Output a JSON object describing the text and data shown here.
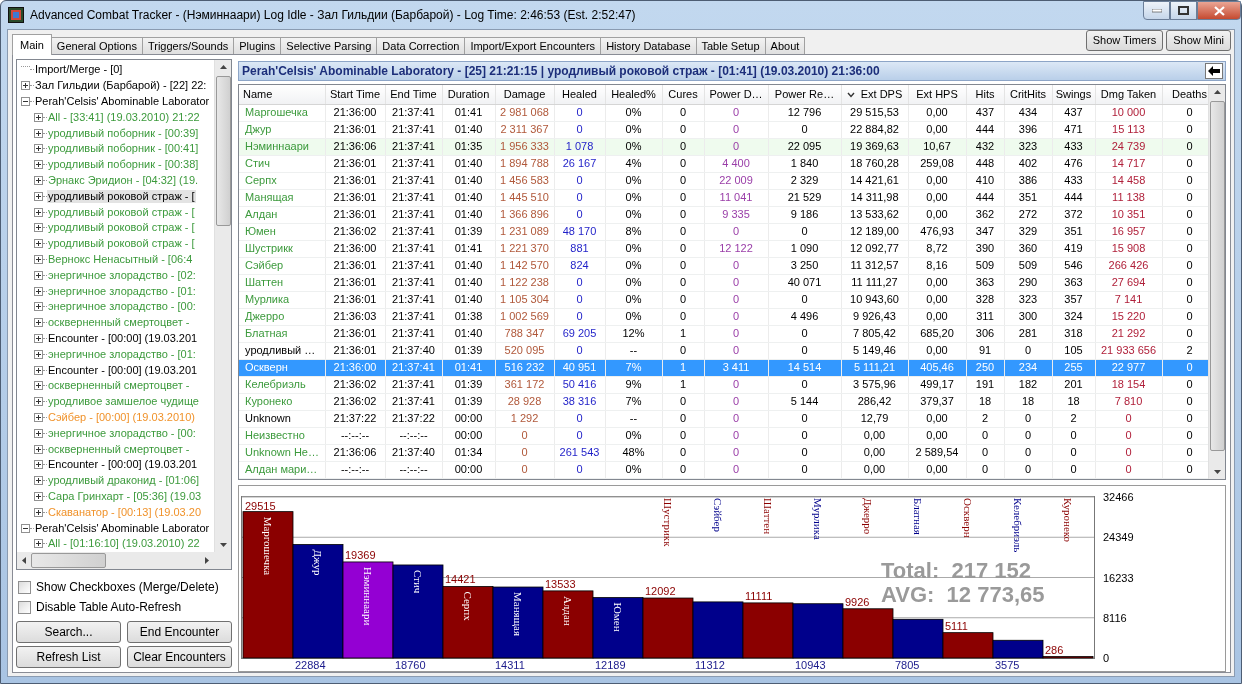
{
  "window": {
    "title": "Advanced Combat Tracker - (Нэминнаари) Log Idle - Зал Гильдии (Барбарой) - Log Time: 2:46:53 (Est. 2:52:47)"
  },
  "tabs": [
    {
      "label": "Main",
      "selected": true
    },
    {
      "label": "General Options",
      "selected": false
    },
    {
      "label": "Triggers/Sounds",
      "selected": false
    },
    {
      "label": "Plugins",
      "selected": false
    },
    {
      "label": "Selective Parsing",
      "selected": false
    },
    {
      "label": "Data Correction",
      "selected": false
    },
    {
      "label": "Import/Export Encounters",
      "selected": false
    },
    {
      "label": "History Database",
      "selected": false
    },
    {
      "label": "Table Setup",
      "selected": false
    },
    {
      "label": "About",
      "selected": false
    }
  ],
  "top_buttons": [
    "Show Timers",
    "Show Mini"
  ],
  "tree": [
    {
      "label": "Import/Merge - [0]",
      "selected": false,
      "color": "#000000"
    },
    {
      "label": "Зал Гильдии (Барбарой) - [22] 22:",
      "selected": false,
      "color": "#000000",
      "expanded": false
    },
    {
      "label": "Perah'Celsis' Abominable Laborator",
      "selected": false,
      "color": "#000000",
      "expanded": true,
      "children": [
        {
          "label": "All - [33:41] (19.03.2010) 21:22",
          "selected": false,
          "color": "#3c9a3c",
          "expanded": false
        },
        {
          "label": "уродливый поборник - [00:39]",
          "selected": false,
          "color": "#3c9a3c",
          "expanded": false
        },
        {
          "label": "уродливый поборник - [00:41]",
          "selected": false,
          "color": "#3c9a3c",
          "expanded": false
        },
        {
          "label": "уродливый поборник - [00:38]",
          "selected": false,
          "color": "#3c9a3c",
          "expanded": false
        },
        {
          "label": "Эрнакс Эридион - [04:32] (19.",
          "selected": false,
          "color": "#3c9a3c",
          "expanded": false
        },
        {
          "label": "уродливый роковой страж - [",
          "selected": true,
          "color": "#000000",
          "expanded": false
        },
        {
          "label": "уродливый роковой страж - [",
          "selected": false,
          "color": "#3c9a3c",
          "expanded": false
        },
        {
          "label": "уродливый роковой страж - [",
          "selected": false,
          "color": "#3c9a3c",
          "expanded": false
        },
        {
          "label": "уродливый роковой страж - [",
          "selected": false,
          "color": "#3c9a3c",
          "expanded": false
        },
        {
          "label": "Вернокс Ненасытный - [06:4",
          "selected": false,
          "color": "#3c9a3c",
          "expanded": false
        },
        {
          "label": "энергичное злорадство - [02:",
          "selected": false,
          "color": "#3c9a3c",
          "expanded": false
        },
        {
          "label": "энергичное злорадство - [01:",
          "selected": false,
          "color": "#3c9a3c",
          "expanded": false
        },
        {
          "label": "энергичное злорадство - [00:",
          "selected": false,
          "color": "#3c9a3c",
          "expanded": false
        },
        {
          "label": "оскверненный смертоцвет -",
          "selected": false,
          "color": "#3c9a3c",
          "expanded": false
        },
        {
          "label": "Encounter - [00:00] (19.03.201",
          "selected": false,
          "color": "#000000",
          "expanded": false
        },
        {
          "label": "энергичное злорадство - [01:",
          "selected": false,
          "color": "#3c9a3c",
          "expanded": false
        },
        {
          "label": "Encounter - [00:00] (19.03.201",
          "selected": false,
          "color": "#000000",
          "expanded": false
        },
        {
          "label": "оскверненный смертоцвет -",
          "selected": false,
          "color": "#3c9a3c",
          "expanded": false
        },
        {
          "label": "уродливое замшелое чудище",
          "selected": false,
          "color": "#3c9a3c",
          "expanded": false
        },
        {
          "label": "Сэйбер - [00:00] (19.03.2010)",
          "selected": false,
          "color": "#f0922a",
          "expanded": false
        },
        {
          "label": "энергичное злорадство - [00:",
          "selected": false,
          "color": "#3c9a3c",
          "expanded": false
        },
        {
          "label": "оскверненный смертоцвет -",
          "selected": false,
          "color": "#3c9a3c",
          "expanded": false
        },
        {
          "label": "Encounter - [00:00] (19.03.201",
          "selected": false,
          "color": "#000000",
          "expanded": false
        },
        {
          "label": "уродливый драконид - [01:06]",
          "selected": false,
          "color": "#3c9a3c",
          "expanded": false
        },
        {
          "label": "Сара Гринхарт - [05:36] (19.03",
          "selected": false,
          "color": "#3c9a3c",
          "expanded": false
        },
        {
          "label": "Скаванатор - [00:13] (19.03.20",
          "selected": false,
          "color": "#f0922a",
          "expanded": false
        }
      ]
    },
    {
      "label": "Perah'Celsis' Abominable Laborator",
      "selected": false,
      "color": "#000000",
      "expanded": true,
      "children": [
        {
          "label": "All - [01:16:10] (19.03.2010) 22",
          "selected": false,
          "color": "#3c9a3c",
          "expanded": false
        }
      ]
    }
  ],
  "options": [
    {
      "label": "Show Checkboxes (Merge/Delete)",
      "checked": false
    },
    {
      "label": "Disable Table Auto-Refresh",
      "checked": false
    }
  ],
  "left_buttons": [
    "Search...",
    "End Encounter",
    "Refresh List",
    "Clear Encounters"
  ],
  "encounter_header": "Perah'Celsis' Abominable Laboratory - [25] 21:21:15  |  уродливый роковой страж - [01:41] (19.03.2010) 21:36:00",
  "table": {
    "columns": [
      {
        "label": "Name",
        "kind": "name",
        "sorted": false
      },
      {
        "label": "Start Time",
        "kind": "plain",
        "sorted": false
      },
      {
        "label": "End Time",
        "kind": "plain",
        "sorted": false
      },
      {
        "label": "Duration",
        "kind": "plain",
        "sorted": false
      },
      {
        "label": "Damage",
        "kind": "damage",
        "sorted": false
      },
      {
        "label": "Healed",
        "kind": "healing",
        "sorted": false
      },
      {
        "label": "Healed%",
        "kind": "plain",
        "sorted": false
      },
      {
        "label": "Cures",
        "kind": "plain",
        "sorted": false
      },
      {
        "label": "Power D…",
        "kind": "drain",
        "sorted": false
      },
      {
        "label": "Power Re…",
        "kind": "plain",
        "sorted": false
      },
      {
        "label": "Ext DPS",
        "kind": "plain",
        "sorted": true
      },
      {
        "label": "Ext HPS",
        "kind": "plain",
        "sorted": false
      },
      {
        "label": "Hits",
        "kind": "plain",
        "sorted": false
      },
      {
        "label": "CritHits",
        "kind": "plain",
        "sorted": false
      },
      {
        "label": "Swings",
        "kind": "plain",
        "sorted": false
      },
      {
        "label": "Dmg Taken",
        "kind": "taken",
        "sorted": false
      },
      {
        "label": "Deaths",
        "kind": "plain",
        "sorted": false
      }
    ],
    "rows": [
      {
        "kind": "player",
        "self": false,
        "selected": false,
        "cells": [
          "Маргошечка",
          "21:36:00",
          "21:37:41",
          "01:41",
          "2 981 068",
          "0",
          "0%",
          "0",
          "0",
          "12 796",
          "29 515,53",
          "0,00",
          "437",
          "434",
          "437",
          "10 000",
          "0"
        ]
      },
      {
        "kind": "player",
        "self": false,
        "selected": false,
        "cells": [
          "Джур",
          "21:36:01",
          "21:37:41",
          "01:40",
          "2 311 367",
          "0",
          "0%",
          "0",
          "0",
          "0",
          "22 884,82",
          "0,00",
          "444",
          "396",
          "471",
          "15 113",
          "0"
        ]
      },
      {
        "kind": "player",
        "self": true,
        "selected": false,
        "cells": [
          "Нэминнаари",
          "21:36:06",
          "21:37:41",
          "01:35",
          "1 956 333",
          "1 078",
          "0%",
          "0",
          "0",
          "22 095",
          "19 369,63",
          "10,67",
          "432",
          "323",
          "433",
          "24 739",
          "0"
        ]
      },
      {
        "kind": "player",
        "self": false,
        "selected": false,
        "cells": [
          "Стич",
          "21:36:01",
          "21:37:41",
          "01:40",
          "1 894 788",
          "26 167",
          "4%",
          "0",
          "4 400",
          "1 840",
          "18 760,28",
          "259,08",
          "448",
          "402",
          "476",
          "14 717",
          "0"
        ]
      },
      {
        "kind": "player",
        "self": false,
        "selected": false,
        "cells": [
          "Серпх",
          "21:36:01",
          "21:37:41",
          "01:40",
          "1 456 583",
          "0",
          "0%",
          "0",
          "22 009",
          "2 329",
          "14 421,61",
          "0,00",
          "410",
          "386",
          "433",
          "14 458",
          "0"
        ]
      },
      {
        "kind": "player",
        "self": false,
        "selected": false,
        "cells": [
          "Манящая",
          "21:36:01",
          "21:37:41",
          "01:40",
          "1 445 510",
          "0",
          "0%",
          "0",
          "11 041",
          "21 529",
          "14 311,98",
          "0,00",
          "444",
          "351",
          "444",
          "11 138",
          "0"
        ]
      },
      {
        "kind": "player",
        "self": false,
        "selected": false,
        "cells": [
          "Алдан",
          "21:36:01",
          "21:37:41",
          "01:40",
          "1 366 896",
          "0",
          "0%",
          "0",
          "9 335",
          "9 186",
          "13 533,62",
          "0,00",
          "362",
          "272",
          "372",
          "10 351",
          "0"
        ]
      },
      {
        "kind": "player",
        "self": false,
        "selected": false,
        "cells": [
          "Юмен",
          "21:36:02",
          "21:37:41",
          "01:39",
          "1 231 089",
          "48 170",
          "8%",
          "0",
          "0",
          "0",
          "12 189,00",
          "476,93",
          "347",
          "329",
          "351",
          "16 957",
          "0"
        ]
      },
      {
        "kind": "player",
        "self": false,
        "selected": false,
        "cells": [
          "Шустрикк",
          "21:36:00",
          "21:37:41",
          "01:41",
          "1 221 370",
          "881",
          "0%",
          "0",
          "12 122",
          "1 090",
          "12 092,77",
          "8,72",
          "390",
          "360",
          "419",
          "15 908",
          "0"
        ]
      },
      {
        "kind": "player",
        "self": false,
        "selected": false,
        "cells": [
          "Сэйбер",
          "21:36:01",
          "21:37:41",
          "01:40",
          "1 142 570",
          "824",
          "0%",
          "0",
          "0",
          "3 250",
          "11 312,57",
          "8,16",
          "509",
          "509",
          "546",
          "266 426",
          "0"
        ]
      },
      {
        "kind": "player",
        "self": false,
        "selected": false,
        "cells": [
          "Шаттен",
          "21:36:01",
          "21:37:41",
          "01:40",
          "1 122 238",
          "0",
          "0%",
          "0",
          "0",
          "40 071",
          "11 111,27",
          "0,00",
          "363",
          "290",
          "363",
          "27 694",
          "0"
        ]
      },
      {
        "kind": "player",
        "self": false,
        "selected": false,
        "cells": [
          "Мурлика",
          "21:36:01",
          "21:37:41",
          "01:40",
          "1 105 304",
          "0",
          "0%",
          "0",
          "0",
          "0",
          "10 943,60",
          "0,00",
          "328",
          "323",
          "357",
          "7 141",
          "0"
        ]
      },
      {
        "kind": "player",
        "self": false,
        "selected": false,
        "cells": [
          "Джерро",
          "21:36:03",
          "21:37:41",
          "01:38",
          "1 002 569",
          "0",
          "0%",
          "0",
          "0",
          "4 496",
          "9 926,43",
          "0,00",
          "311",
          "300",
          "324",
          "15 220",
          "0"
        ]
      },
      {
        "kind": "player",
        "self": false,
        "selected": false,
        "cells": [
          "Блатная",
          "21:36:01",
          "21:37:41",
          "01:40",
          "788 347",
          "69 205",
          "12%",
          "1",
          "0",
          "0",
          "7 805,42",
          "685,20",
          "306",
          "281",
          "318",
          "21 292",
          "0"
        ]
      },
      {
        "kind": "other",
        "self": false,
        "selected": false,
        "cells": [
          "уродливый …",
          "21:36:01",
          "21:37:40",
          "01:39",
          "520 095",
          "0",
          "--",
          "0",
          "0",
          "0",
          "5 149,46",
          "0,00",
          "91",
          "0",
          "105",
          "21 933 656",
          "2"
        ]
      },
      {
        "kind": "player",
        "self": false,
        "selected": true,
        "cells": [
          "Оскверн",
          "21:36:00",
          "21:37:41",
          "01:41",
          "516 232",
          "40 951",
          "7%",
          "1",
          "3 411",
          "14 514",
          "5 111,21",
          "405,46",
          "250",
          "234",
          "255",
          "22 977",
          "0"
        ]
      },
      {
        "kind": "player",
        "self": false,
        "selected": false,
        "cells": [
          "Келебриэль",
          "21:36:02",
          "21:37:41",
          "01:39",
          "361 172",
          "50 416",
          "9%",
          "1",
          "0",
          "0",
          "3 575,96",
          "499,17",
          "191",
          "182",
          "201",
          "18 154",
          "0"
        ]
      },
      {
        "kind": "player",
        "self": false,
        "selected": false,
        "cells": [
          "Куронеко",
          "21:36:02",
          "21:37:41",
          "01:39",
          "28 928",
          "38 316",
          "7%",
          "0",
          "0",
          "5 144",
          "286,42",
          "379,37",
          "18",
          "18",
          "18",
          "7 810",
          "0"
        ]
      },
      {
        "kind": "other",
        "self": false,
        "selected": false,
        "cells": [
          "Unknown",
          "21:37:22",
          "21:37:22",
          "00:00",
          "1 292",
          "0",
          "--",
          "0",
          "0",
          "0",
          "12,79",
          "0,00",
          "2",
          "0",
          "2",
          "0",
          "0"
        ]
      },
      {
        "kind": "player",
        "self": false,
        "selected": false,
        "cells": [
          "Неизвестно",
          "--:--:--",
          "--:--:--",
          "00:00",
          "0",
          "0",
          "0%",
          "0",
          "0",
          "0",
          "0,00",
          "0,00",
          "0",
          "0",
          "0",
          "0",
          "0"
        ]
      },
      {
        "kind": "player",
        "self": false,
        "selected": false,
        "cells": [
          "Unknown Не…",
          "21:36:06",
          "21:37:40",
          "01:34",
          "0",
          "261 543",
          "48%",
          "0",
          "0",
          "0",
          "0,00",
          "2 589,54",
          "0",
          "0",
          "0",
          "0",
          "0"
        ]
      },
      {
        "kind": "player",
        "self": false,
        "selected": false,
        "cells": [
          "Алдан мари…",
          "--:--:--",
          "--:--:--",
          "00:00",
          "0",
          "0",
          "0%",
          "0",
          "0",
          "0",
          "0,00",
          "0,00",
          "0",
          "0",
          "0",
          "0",
          "0"
        ]
      }
    ]
  },
  "chart": {
    "chart_data": {
      "type": "bar",
      "categories": [
        "Маргошечка",
        "Джур",
        "Нэминнаари",
        "Стич",
        "Серпх",
        "Манящая",
        "Алдан",
        "Юмен",
        "Шустрикк",
        "Сэйбер",
        "Шаттен",
        "Мурлика",
        "Джерро",
        "Блатная",
        "Оскверн",
        "Келебриэль",
        "Куронеко"
      ],
      "series": [
        {
          "values": [
            29515,
            22884,
            19369,
            18760,
            14421,
            14311,
            13533,
            12189,
            12092,
            11312,
            11111,
            10943,
            9926,
            7805,
            5111,
            3575,
            286
          ]
        }
      ],
      "colors": [
        "#8b0000",
        "#00008b",
        "#9400d3",
        "#00008b",
        "#8b0000",
        "#00008b",
        "#8b0000",
        "#00008b",
        "#8b0000",
        "#00008b",
        "#8b0000",
        "#00008b",
        "#8b0000",
        "#00008b",
        "#8b0000",
        "#00008b",
        "#8b0000"
      ],
      "grid": true,
      "ylim": [
        0,
        32466
      ],
      "yticks": [
        0,
        8116,
        16233,
        24349,
        32466
      ],
      "data_labels": true,
      "annotations": [
        {
          "text": "Total:  217 152"
        },
        {
          "text": "AVG:  12 773,65"
        }
      ]
    }
  }
}
